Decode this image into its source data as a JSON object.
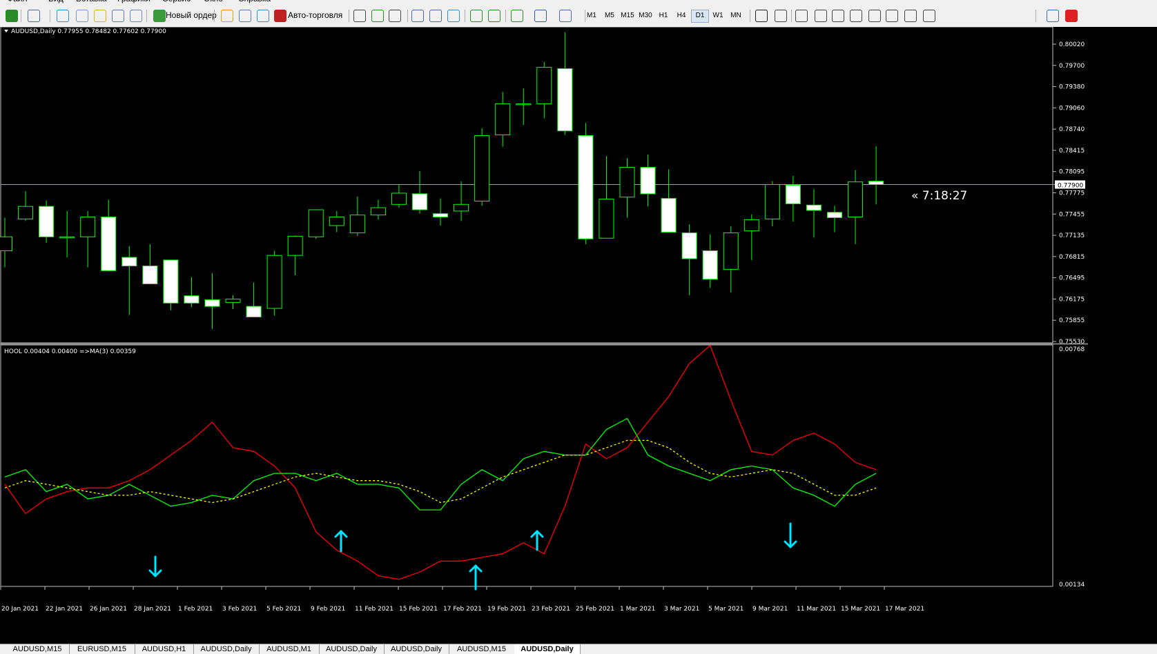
{
  "menu": [
    "Файл",
    "Вид",
    "Вставка",
    "Графики",
    "Сервис",
    "Окно",
    "Справка"
  ],
  "toolbar": {
    "new_order": "Новый ордер",
    "auto_trading": "Авто-торговля",
    "timeframes": [
      "M1",
      "M5",
      "M15",
      "M30",
      "H1",
      "H4",
      "D1",
      "W1",
      "MN"
    ],
    "active_timeframe": "D1",
    "icons": [
      "new-chart-icon",
      "profiles-icon",
      "market-watch-icon",
      "navigator-icon",
      "favorites-icon",
      "data-window-icon",
      "strategy-tester-icon",
      "new-order-icon",
      "metaeditor-icon",
      "options-icon",
      "signals-icon",
      "auto-trading-icon",
      "bar-chart-icon",
      "candlestick-icon",
      "line-chart-icon",
      "zoom-in-icon",
      "zoom-out-icon",
      "tile-windows-icon",
      "auto-scroll-icon",
      "chart-shift-icon",
      "indicators-icon",
      "periods-icon",
      "templates-icon",
      "cursor-icon",
      "crosshair-icon",
      "vertical-line-icon",
      "horizontal-line-icon",
      "trendline-icon",
      "fibonacci-icon",
      "channel-icon",
      "text-icon",
      "text-label-icon",
      "arrows-icon",
      "search-icon",
      "notification-icon"
    ]
  },
  "main_chart": {
    "header": "AUDUSD,Daily  0.77955 0.78482 0.77602 0.77900",
    "price_labels": [
      "0.80020",
      "0.79700",
      "0.79380",
      "0.79060",
      "0.78740",
      "0.78415",
      "0.78095",
      "0.77775",
      "0.77455",
      "0.77135",
      "0.76815",
      "0.76495",
      "0.76175",
      "0.75855",
      "0.75530"
    ],
    "current_price": "0.77900",
    "timer": "« 7:18:27"
  },
  "indicator": {
    "header": "HOOL 0.00404 0.00400  =>MA(3) 0.00359",
    "scale_labels": [
      "0.00768",
      "0.00134"
    ]
  },
  "dates": [
    "20 Jan 2021",
    "22 Jan 2021",
    "26 Jan 2021",
    "28 Jan 2021",
    "1 Feb 2021",
    "3 Feb 2021",
    "5 Feb 2021",
    "9 Feb 2021",
    "11 Feb 2021",
    "15 Feb 2021",
    "17 Feb 2021",
    "19 Feb 2021",
    "23 Feb 2021",
    "25 Feb 2021",
    "1 Mar 2021",
    "3 Mar 2021",
    "5 Mar 2021",
    "9 Mar 2021",
    "11 Mar 2021",
    "15 Mar 2021",
    "17 Mar 2021"
  ],
  "tabs": [
    "AUDUSD,M15",
    "EURUSD,M15",
    "AUDUSD,H1",
    "AUDUSD,Daily",
    "AUDUSD,M1",
    "AUDUSD,Daily",
    "AUDUSD,Daily",
    "AUDUSD,M15",
    "AUDUSD,Daily"
  ],
  "active_tab": 8,
  "colors": {
    "bull_border": "#00ff00",
    "bear_fill": "#ffffff",
    "red_line": "#ff0000",
    "green_line": "#00ff00",
    "ma_line": "#ffff00",
    "arrow": "#00e5ff",
    "grid_line": "#c0c0c0"
  },
  "chart_data": [
    {
      "type": "candlestick",
      "title": "AUDUSD,Daily",
      "x": [
        "19 Jan 2021",
        "20 Jan 2021",
        "21 Jan 2021",
        "22 Jan 2021",
        "25 Jan 2021",
        "26 Jan 2021",
        "27 Jan 2021",
        "28 Jan 2021",
        "29 Jan 2021",
        "1 Feb 2021",
        "2 Feb 2021",
        "3 Feb 2021",
        "4 Feb 2021",
        "5 Feb 2021",
        "8 Feb 2021",
        "9 Feb 2021",
        "10 Feb 2021",
        "11 Feb 2021",
        "12 Feb 2021",
        "15 Feb 2021",
        "16 Feb 2021",
        "17 Feb 2021",
        "18 Feb 2021",
        "19 Feb 2021",
        "22 Feb 2021",
        "23 Feb 2021",
        "24 Feb 2021",
        "25 Feb 2021",
        "26 Feb 2021",
        "1 Mar 2021",
        "2 Mar 2021",
        "3 Mar 2021",
        "4 Mar 2021",
        "5 Mar 2021",
        "8 Mar 2021",
        "9 Mar 2021",
        "10 Mar 2021",
        "11 Mar 2021",
        "12 Mar 2021",
        "15 Mar 2021",
        "16 Mar 2021",
        "17 Mar 2021",
        "18 Mar 2021"
      ],
      "open": [
        0.769,
        0.7738,
        0.7757,
        0.7711,
        0.7711,
        0.7741,
        0.768,
        0.7667,
        0.7676,
        0.7622,
        0.7616,
        0.7612,
        0.7606,
        0.7603,
        0.7683,
        0.7711,
        0.7728,
        0.7717,
        0.7744,
        0.776,
        0.7776,
        0.7746,
        0.775,
        0.7765,
        0.7865,
        0.7912,
        0.7912,
        0.7965,
        0.7864,
        0.7709,
        0.7771,
        0.7816,
        0.7769,
        0.7717,
        0.769,
        0.7662,
        0.772,
        0.7738,
        0.7789,
        0.7759,
        0.7748,
        0.7741,
        0.7795
      ],
      "high": [
        0.774,
        0.778,
        0.7766,
        0.775,
        0.775,
        0.7767,
        0.7697,
        0.77,
        0.762,
        0.765,
        0.7656,
        0.7623,
        0.7642,
        0.769,
        0.7713,
        0.774,
        0.775,
        0.7772,
        0.7767,
        0.779,
        0.781,
        0.7769,
        0.7795,
        0.7875,
        0.793,
        0.7935,
        0.7975,
        0.802,
        0.7883,
        0.7833,
        0.783,
        0.7835,
        0.7813,
        0.773,
        0.7715,
        0.7727,
        0.7745,
        0.7795,
        0.7803,
        0.7783,
        0.7758,
        0.7812,
        0.7848
      ],
      "low": [
        0.7665,
        0.7735,
        0.7702,
        0.768,
        0.7665,
        0.7662,
        0.7593,
        0.764,
        0.76,
        0.7605,
        0.7572,
        0.7602,
        0.7597,
        0.7592,
        0.7653,
        0.7708,
        0.7718,
        0.7712,
        0.7737,
        0.7755,
        0.7746,
        0.7728,
        0.7735,
        0.7758,
        0.7847,
        0.788,
        0.789,
        0.7865,
        0.77,
        0.7709,
        0.774,
        0.7757,
        0.7718,
        0.7623,
        0.7634,
        0.7627,
        0.7676,
        0.7727,
        0.7734,
        0.771,
        0.7718,
        0.77,
        0.776
      ],
      "close": [
        0.7711,
        0.7757,
        0.7711,
        0.7711,
        0.7741,
        0.766,
        0.7667,
        0.764,
        0.7611,
        0.7611,
        0.7606,
        0.7617,
        0.759,
        0.7683,
        0.7712,
        0.7752,
        0.7741,
        0.7744,
        0.7755,
        0.7777,
        0.7752,
        0.7741,
        0.776,
        0.7864,
        0.7912,
        0.7912,
        0.7967,
        0.7871,
        0.7708,
        0.7768,
        0.7816,
        0.7776,
        0.7718,
        0.7678,
        0.7647,
        0.7717,
        0.7737,
        0.779,
        0.7761,
        0.7751,
        0.774,
        0.7794,
        0.779
      ]
    },
    {
      "type": "line",
      "title": "HOOL  =>MA(3)",
      "x": [
        "19 Jan 2021",
        "20 Jan 2021",
        "21 Jan 2021",
        "22 Jan 2021",
        "25 Jan 2021",
        "26 Jan 2021",
        "27 Jan 2021",
        "28 Jan 2021",
        "29 Jan 2021",
        "1 Feb 2021",
        "2 Feb 2021",
        "3 Feb 2021",
        "4 Feb 2021",
        "5 Feb 2021",
        "8 Feb 2021",
        "9 Feb 2021",
        "10 Feb 2021",
        "11 Feb 2021",
        "12 Feb 2021",
        "15 Feb 2021",
        "16 Feb 2021",
        "17 Feb 2021",
        "18 Feb 2021",
        "19 Feb 2021",
        "22 Feb 2021",
        "23 Feb 2021",
        "24 Feb 2021",
        "25 Feb 2021",
        "26 Feb 2021",
        "1 Mar 2021",
        "2 Mar 2021",
        "3 Mar 2021",
        "4 Mar 2021",
        "5 Mar 2021",
        "8 Mar 2021",
        "9 Mar 2021",
        "10 Mar 2021",
        "11 Mar 2021",
        "12 Mar 2021",
        "15 Mar 2021",
        "16 Mar 2021",
        "17 Mar 2021",
        "18 Mar 2021"
      ],
      "ylim": [
        0.00134,
        0.00768
      ],
      "series": [
        {
          "color": "red",
          "values": [
            0.004,
            0.0032,
            0.0036,
            0.0038,
            0.0039,
            0.0039,
            0.0041,
            0.0044,
            0.0048,
            0.0052,
            0.0057,
            0.005,
            0.0049,
            0.0045,
            0.0039,
            0.0027,
            0.0022,
            0.0019,
            0.0015,
            0.0014,
            0.0016,
            0.0019,
            0.0019,
            0.002,
            0.0021,
            0.0024,
            0.0021,
            0.0034,
            0.0051,
            0.0047,
            0.005,
            0.0057,
            0.0064,
            0.0073,
            0.0078,
            0.0063,
            0.0049,
            0.0048,
            0.0052,
            0.0054,
            0.0051,
            0.0046,
            0.0044
          ]
        },
        {
          "color": "green",
          "values": [
            0.0042,
            0.0044,
            0.0038,
            0.004,
            0.0036,
            0.0037,
            0.004,
            0.0037,
            0.0034,
            0.0035,
            0.0037,
            0.0036,
            0.0041,
            0.0043,
            0.0043,
            0.0041,
            0.0043,
            0.004,
            0.004,
            0.0039,
            0.0033,
            0.0033,
            0.004,
            0.0044,
            0.0041,
            0.0047,
            0.0049,
            0.0048,
            0.0048,
            0.0055,
            0.0058,
            0.0048,
            0.0045,
            0.0043,
            0.0041,
            0.0044,
            0.0045,
            0.0044,
            0.0039,
            0.0037,
            0.0034,
            0.004,
            0.0043
          ]
        },
        {
          "color": "yellow",
          "dashed": true,
          "values": [
            0.0039,
            0.0041,
            0.004,
            0.0039,
            0.0038,
            0.0037,
            0.0037,
            0.0038,
            0.0037,
            0.0036,
            0.0035,
            0.0036,
            0.0038,
            0.004,
            0.0042,
            0.0043,
            0.0042,
            0.0041,
            0.0041,
            0.004,
            0.0038,
            0.0035,
            0.0036,
            0.0039,
            0.0042,
            0.0044,
            0.0046,
            0.0048,
            0.0048,
            0.005,
            0.0052,
            0.0052,
            0.005,
            0.0046,
            0.0043,
            0.0042,
            0.0043,
            0.0044,
            0.0043,
            0.004,
            0.0037,
            0.0037,
            0.0039
          ]
        }
      ]
    }
  ]
}
